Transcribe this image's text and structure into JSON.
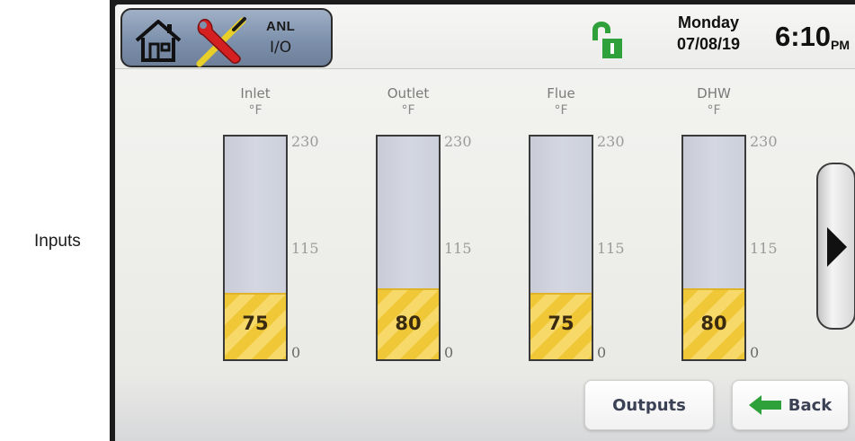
{
  "side_label": "Inputs",
  "header": {
    "anl_label": "ANL",
    "io_label": "I/O",
    "day": "Monday",
    "date": "07/08/19",
    "time": "6:10",
    "ampm": "PM"
  },
  "icons": {
    "home": "home-icon",
    "tools": "tools-icon",
    "lock": "unlocked-padlock-icon",
    "next": "right-arrow-icon",
    "back": "left-arrow-icon"
  },
  "colors": {
    "nav_panel": "#7e91ac",
    "gauge_fill": "#f0c736",
    "lock_green": "#2fa13a",
    "back_arrow_green": "#2fa13a"
  },
  "gauges": [
    {
      "title": "Inlet",
      "unit": "°F",
      "value": "75",
      "max": "230",
      "mid": "115",
      "min": "0",
      "level": 0.3
    },
    {
      "title": "Outlet",
      "unit": "°F",
      "value": "80",
      "max": "230",
      "mid": "115",
      "min": "0",
      "level": 0.32
    },
    {
      "title": "Flue",
      "unit": "°F",
      "value": "75",
      "max": "230",
      "mid": "115",
      "min": "0",
      "level": 0.3
    },
    {
      "title": "DHW",
      "unit": "°F",
      "value": "80",
      "max": "230",
      "mid": "115",
      "min": "0",
      "level": 0.32
    }
  ],
  "buttons": {
    "outputs": "Outputs",
    "back": "Back"
  }
}
